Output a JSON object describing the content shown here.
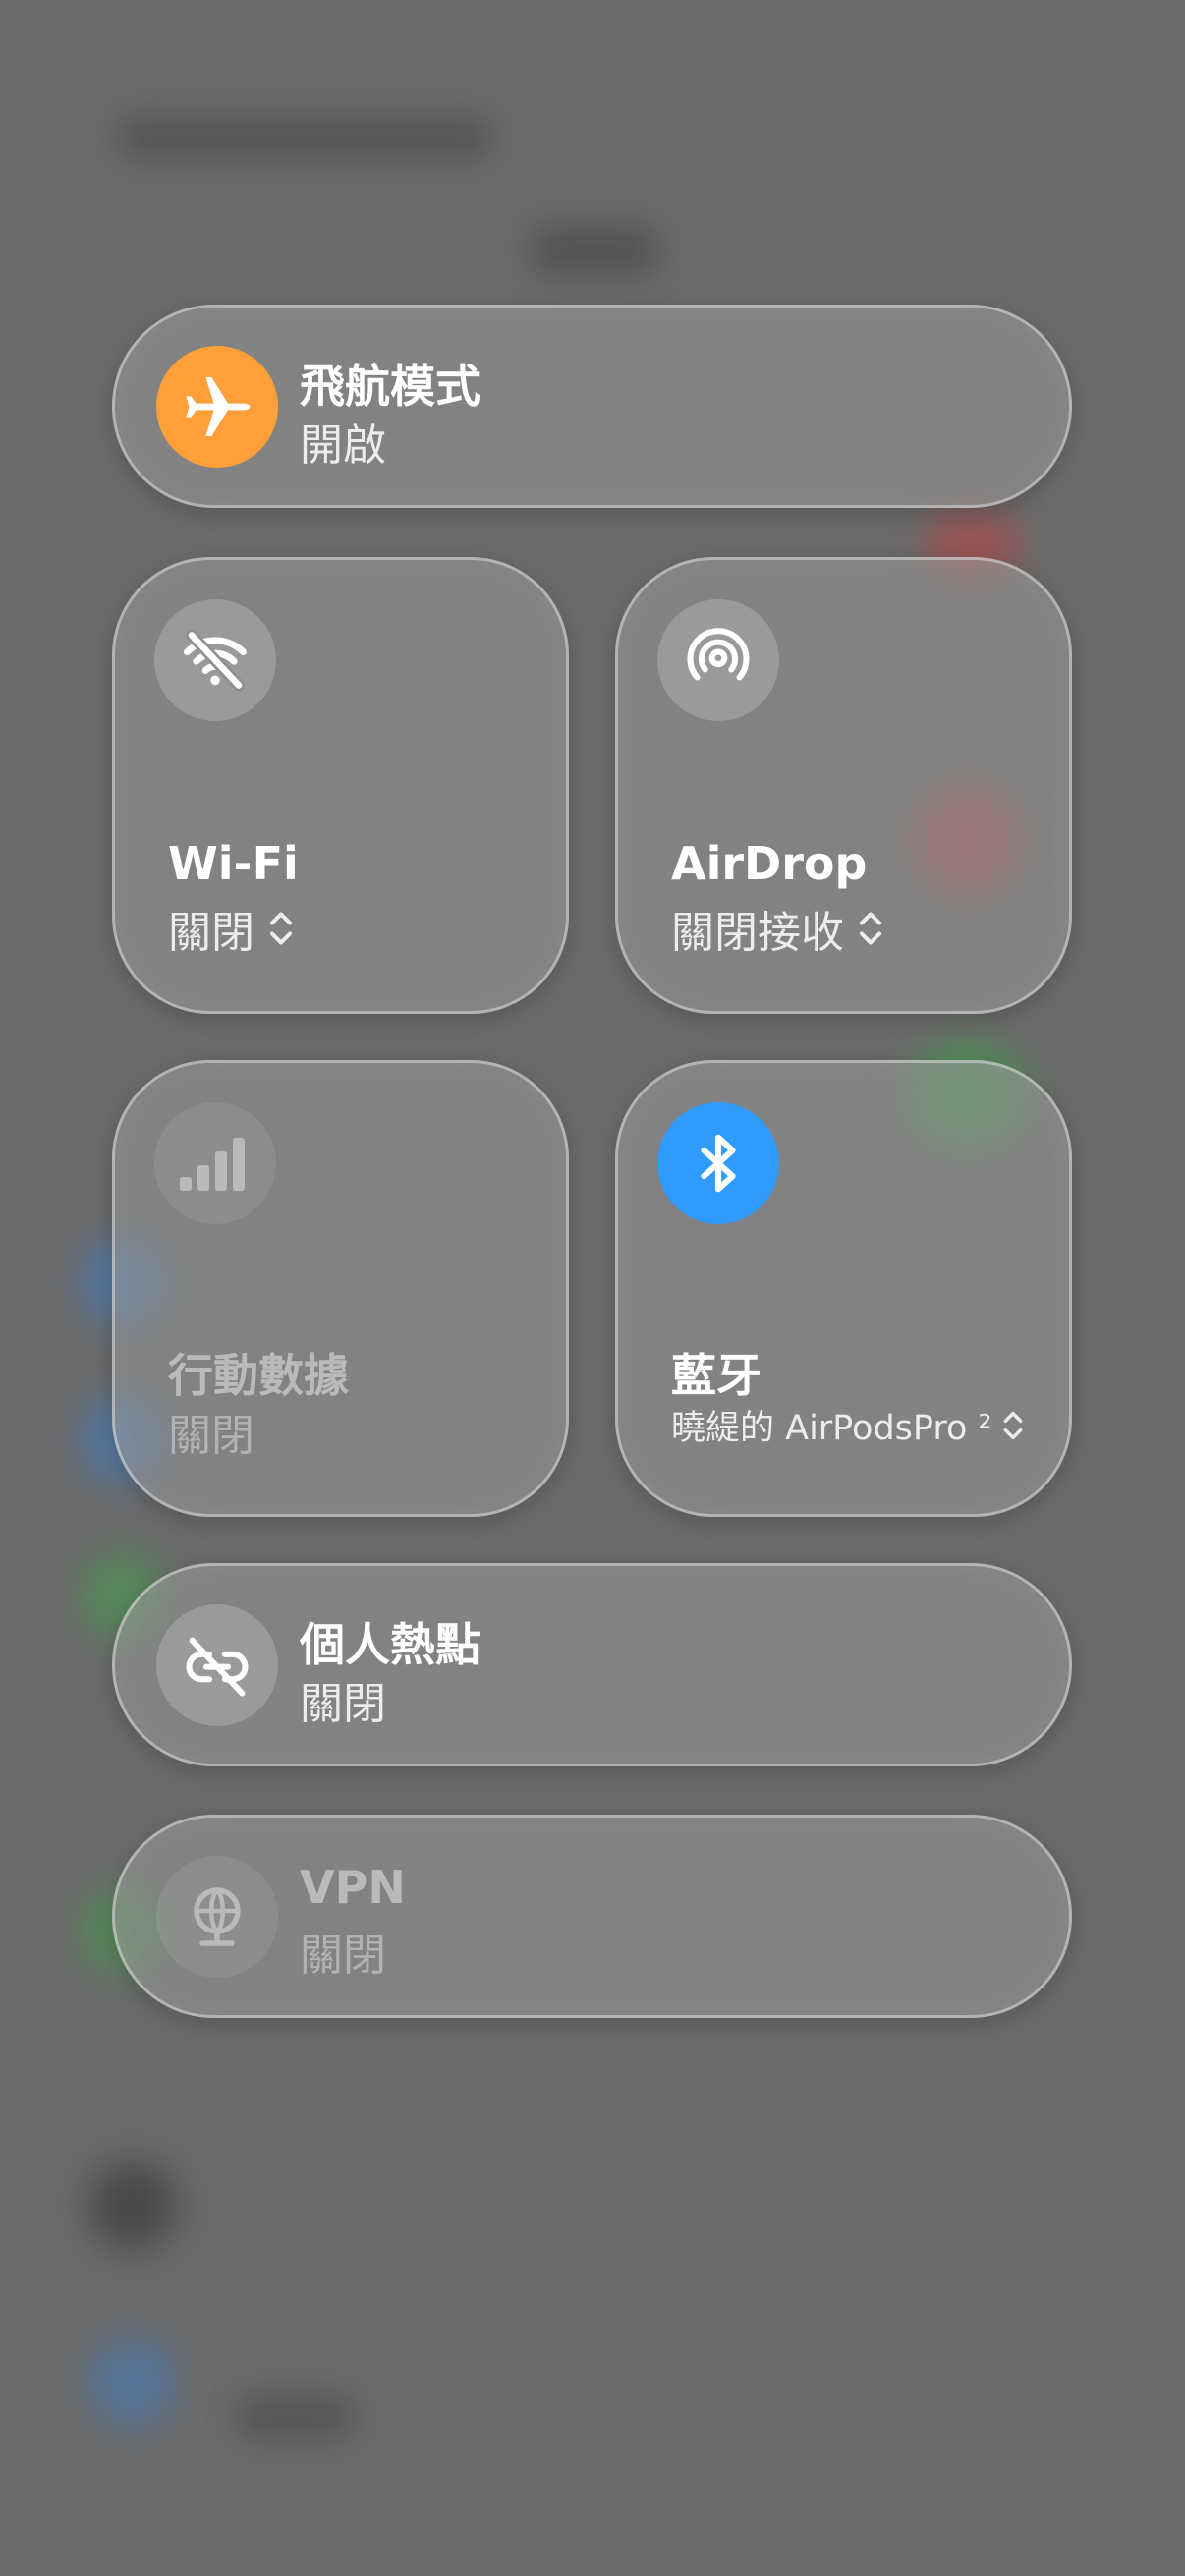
{
  "colors": {
    "airplane_accent": "#FF9F3A",
    "bluetooth_accent": "#2F9BFF",
    "background": "#6a6a6a"
  },
  "airplane": {
    "title": "飛航模式",
    "status": "開啟",
    "icon": "airplane-icon",
    "active": true
  },
  "wifi": {
    "title": "Wi-Fi",
    "status": "關閉",
    "icon": "wifi-off-icon"
  },
  "airdrop": {
    "title": "AirDrop",
    "status": "關閉接收",
    "icon": "airdrop-icon"
  },
  "cellular": {
    "title": "行動數據",
    "status": "關閉",
    "icon": "cellular-bars-icon",
    "disabled": true
  },
  "bluetooth": {
    "title": "藍牙",
    "status": "曉緹的 AirPodsPro ²",
    "icon": "bluetooth-icon",
    "active": true
  },
  "hotspot": {
    "title": "個人熱點",
    "status": "關閉",
    "icon": "hotspot-link-off-icon"
  },
  "vpn": {
    "title": "VPN",
    "status": "關閉",
    "icon": "vpn-globe-icon",
    "disabled": true
  }
}
